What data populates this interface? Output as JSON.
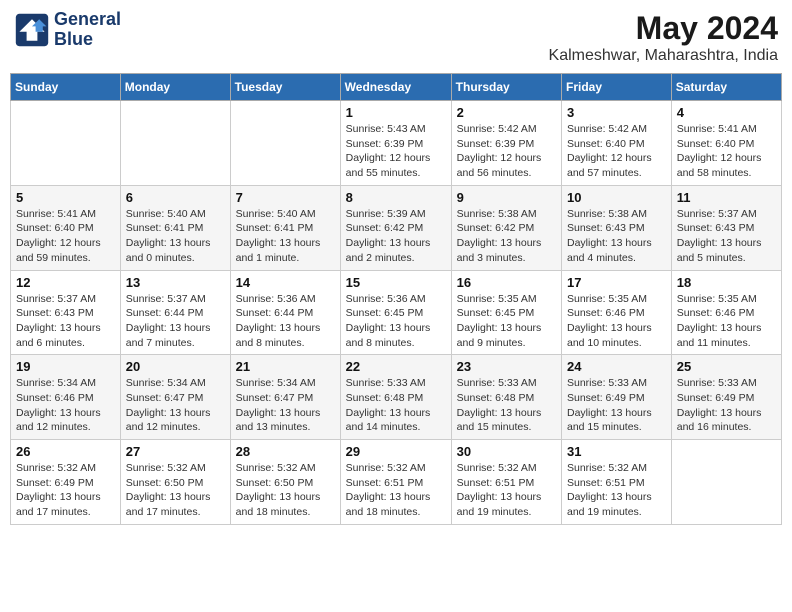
{
  "header": {
    "logo_line1": "General",
    "logo_line2": "Blue",
    "title": "May 2024",
    "subtitle": "Kalmeshwar, Maharashtra, India"
  },
  "weekdays": [
    "Sunday",
    "Monday",
    "Tuesday",
    "Wednesday",
    "Thursday",
    "Friday",
    "Saturday"
  ],
  "weeks": [
    [
      {
        "day": "",
        "info": ""
      },
      {
        "day": "",
        "info": ""
      },
      {
        "day": "",
        "info": ""
      },
      {
        "day": "1",
        "info": "Sunrise: 5:43 AM\nSunset: 6:39 PM\nDaylight: 12 hours\nand 55 minutes."
      },
      {
        "day": "2",
        "info": "Sunrise: 5:42 AM\nSunset: 6:39 PM\nDaylight: 12 hours\nand 56 minutes."
      },
      {
        "day": "3",
        "info": "Sunrise: 5:42 AM\nSunset: 6:40 PM\nDaylight: 12 hours\nand 57 minutes."
      },
      {
        "day": "4",
        "info": "Sunrise: 5:41 AM\nSunset: 6:40 PM\nDaylight: 12 hours\nand 58 minutes."
      }
    ],
    [
      {
        "day": "5",
        "info": "Sunrise: 5:41 AM\nSunset: 6:40 PM\nDaylight: 12 hours\nand 59 minutes."
      },
      {
        "day": "6",
        "info": "Sunrise: 5:40 AM\nSunset: 6:41 PM\nDaylight: 13 hours\nand 0 minutes."
      },
      {
        "day": "7",
        "info": "Sunrise: 5:40 AM\nSunset: 6:41 PM\nDaylight: 13 hours\nand 1 minute."
      },
      {
        "day": "8",
        "info": "Sunrise: 5:39 AM\nSunset: 6:42 PM\nDaylight: 13 hours\nand 2 minutes."
      },
      {
        "day": "9",
        "info": "Sunrise: 5:38 AM\nSunset: 6:42 PM\nDaylight: 13 hours\nand 3 minutes."
      },
      {
        "day": "10",
        "info": "Sunrise: 5:38 AM\nSunset: 6:43 PM\nDaylight: 13 hours\nand 4 minutes."
      },
      {
        "day": "11",
        "info": "Sunrise: 5:37 AM\nSunset: 6:43 PM\nDaylight: 13 hours\nand 5 minutes."
      }
    ],
    [
      {
        "day": "12",
        "info": "Sunrise: 5:37 AM\nSunset: 6:43 PM\nDaylight: 13 hours\nand 6 minutes."
      },
      {
        "day": "13",
        "info": "Sunrise: 5:37 AM\nSunset: 6:44 PM\nDaylight: 13 hours\nand 7 minutes."
      },
      {
        "day": "14",
        "info": "Sunrise: 5:36 AM\nSunset: 6:44 PM\nDaylight: 13 hours\nand 8 minutes."
      },
      {
        "day": "15",
        "info": "Sunrise: 5:36 AM\nSunset: 6:45 PM\nDaylight: 13 hours\nand 8 minutes."
      },
      {
        "day": "16",
        "info": "Sunrise: 5:35 AM\nSunset: 6:45 PM\nDaylight: 13 hours\nand 9 minutes."
      },
      {
        "day": "17",
        "info": "Sunrise: 5:35 AM\nSunset: 6:46 PM\nDaylight: 13 hours\nand 10 minutes."
      },
      {
        "day": "18",
        "info": "Sunrise: 5:35 AM\nSunset: 6:46 PM\nDaylight: 13 hours\nand 11 minutes."
      }
    ],
    [
      {
        "day": "19",
        "info": "Sunrise: 5:34 AM\nSunset: 6:46 PM\nDaylight: 13 hours\nand 12 minutes."
      },
      {
        "day": "20",
        "info": "Sunrise: 5:34 AM\nSunset: 6:47 PM\nDaylight: 13 hours\nand 12 minutes."
      },
      {
        "day": "21",
        "info": "Sunrise: 5:34 AM\nSunset: 6:47 PM\nDaylight: 13 hours\nand 13 minutes."
      },
      {
        "day": "22",
        "info": "Sunrise: 5:33 AM\nSunset: 6:48 PM\nDaylight: 13 hours\nand 14 minutes."
      },
      {
        "day": "23",
        "info": "Sunrise: 5:33 AM\nSunset: 6:48 PM\nDaylight: 13 hours\nand 15 minutes."
      },
      {
        "day": "24",
        "info": "Sunrise: 5:33 AM\nSunset: 6:49 PM\nDaylight: 13 hours\nand 15 minutes."
      },
      {
        "day": "25",
        "info": "Sunrise: 5:33 AM\nSunset: 6:49 PM\nDaylight: 13 hours\nand 16 minutes."
      }
    ],
    [
      {
        "day": "26",
        "info": "Sunrise: 5:32 AM\nSunset: 6:49 PM\nDaylight: 13 hours\nand 17 minutes."
      },
      {
        "day": "27",
        "info": "Sunrise: 5:32 AM\nSunset: 6:50 PM\nDaylight: 13 hours\nand 17 minutes."
      },
      {
        "day": "28",
        "info": "Sunrise: 5:32 AM\nSunset: 6:50 PM\nDaylight: 13 hours\nand 18 minutes."
      },
      {
        "day": "29",
        "info": "Sunrise: 5:32 AM\nSunset: 6:51 PM\nDaylight: 13 hours\nand 18 minutes."
      },
      {
        "day": "30",
        "info": "Sunrise: 5:32 AM\nSunset: 6:51 PM\nDaylight: 13 hours\nand 19 minutes."
      },
      {
        "day": "31",
        "info": "Sunrise: 5:32 AM\nSunset: 6:51 PM\nDaylight: 13 hours\nand 19 minutes."
      },
      {
        "day": "",
        "info": ""
      }
    ]
  ]
}
